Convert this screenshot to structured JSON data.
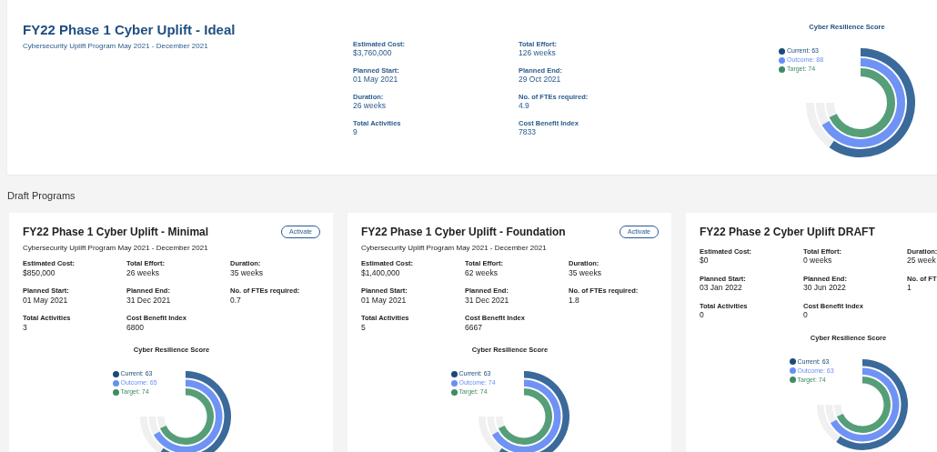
{
  "ideal": {
    "title": "FY22 Phase 1 Cyber Uplift - Ideal",
    "subtitle": "Cybersecurity Uplift Program May 2021 - December 2021",
    "stats": [
      {
        "label": "Estimated Cost:",
        "value": "$3,760,000"
      },
      {
        "label": "Planned Start:",
        "value": "01 May 2021"
      },
      {
        "label": "Duration:",
        "value": "26 weeks"
      },
      {
        "label": "Total Activities",
        "value": "9"
      },
      {
        "label": "Total Effort:",
        "value": "126 weeks"
      },
      {
        "label": "Planned End:",
        "value": "29 Oct 2021"
      },
      {
        "label": "No. of FTEs required:",
        "value": "4.9"
      },
      {
        "label": "Cost Benefit Index",
        "value": "7833"
      }
    ],
    "score": {
      "title": "Cyber Resilience Score",
      "meters": [
        {
          "label": "Current: 63",
          "color": "#1b4a78"
        },
        {
          "label": "Outcome: 88",
          "color": "#6a8ff4"
        },
        {
          "label": "Target: 74",
          "color": "#3f8c63"
        }
      ]
    }
  },
  "section_title": "Draft Programs",
  "drafts": [
    {
      "title": "FY22 Phase 1 Cyber Uplift - Minimal",
      "subtitle": "Cybersecurity Uplift Program May 2021 - December 2021",
      "action": "Activate",
      "stats": [
        {
          "label": "Estimated Cost:",
          "value": "$850,000"
        },
        {
          "label": "Total Effort:",
          "value": "26 weeks"
        },
        {
          "label": "Duration:",
          "value": "35 weeks"
        },
        {
          "label": "Planned Start:",
          "value": "01 May 2021"
        },
        {
          "label": "Planned End:",
          "value": "31 Dec 2021"
        },
        {
          "label": "No. of FTEs required:",
          "value": "0.7"
        },
        {
          "label": "Total Activities",
          "value": "3"
        },
        {
          "label": "Cost Benefit Index",
          "value": "6800"
        }
      ],
      "score": {
        "title": "Cyber Resilience Score",
        "meters": [
          {
            "label": "Current: 63",
            "color": "#1b4a78"
          },
          {
            "label": "Outcome: 65",
            "color": "#6a8ff4"
          },
          {
            "label": "Target: 74",
            "color": "#3f8c63"
          }
        ]
      }
    },
    {
      "title": "FY22 Phase 1 Cyber Uplift - Foundation",
      "subtitle": "Cybersecurity Uplift Program May 2021 - December 2021",
      "action": "Activate",
      "stats": [
        {
          "label": "Estimated Cost:",
          "value": "$1,400,000"
        },
        {
          "label": "Total Effort:",
          "value": "62 weeks"
        },
        {
          "label": "Duration:",
          "value": "35 weeks"
        },
        {
          "label": "Planned Start:",
          "value": "01 May 2021"
        },
        {
          "label": "Planned End:",
          "value": "31 Dec 2021"
        },
        {
          "label": "No. of FTEs required:",
          "value": "1.8"
        },
        {
          "label": "Total Activities",
          "value": "5"
        },
        {
          "label": "Cost Benefit Index",
          "value": "6667"
        }
      ],
      "score": {
        "title": "Cyber Resilience Score",
        "meters": [
          {
            "label": "Current: 63",
            "color": "#1b4a78"
          },
          {
            "label": "Outcome: 74",
            "color": "#6a8ff4"
          },
          {
            "label": "Target: 74",
            "color": "#3f8c63"
          }
        ]
      }
    },
    {
      "title": "FY22 Phase 2 Cyber Uplift DRAFT",
      "stats": [
        {
          "label": "Estimated Cost:",
          "value": "$0"
        },
        {
          "label": "Total Effort:",
          "value": "0 weeks"
        },
        {
          "label": "Duration:",
          "value": "25 week"
        },
        {
          "label": "Planned Start:",
          "value": "03 Jan 2022"
        },
        {
          "label": "Planned End:",
          "value": "30 Jun 2022"
        },
        {
          "label": "No. of FT",
          "value": "1"
        },
        {
          "label": "Total Activities",
          "value": "0"
        },
        {
          "label": "Cost Benefit Index",
          "value": "0"
        }
      ],
      "score": {
        "title": "Cyber Resilience Score",
        "meters": [
          {
            "label": "Current: 63",
            "color": "#1b4a78"
          },
          {
            "label": "Outcome: 63",
            "color": "#6a8ff4"
          },
          {
            "label": "Target: 74",
            "color": "#3f8c63"
          }
        ]
      }
    }
  ]
}
